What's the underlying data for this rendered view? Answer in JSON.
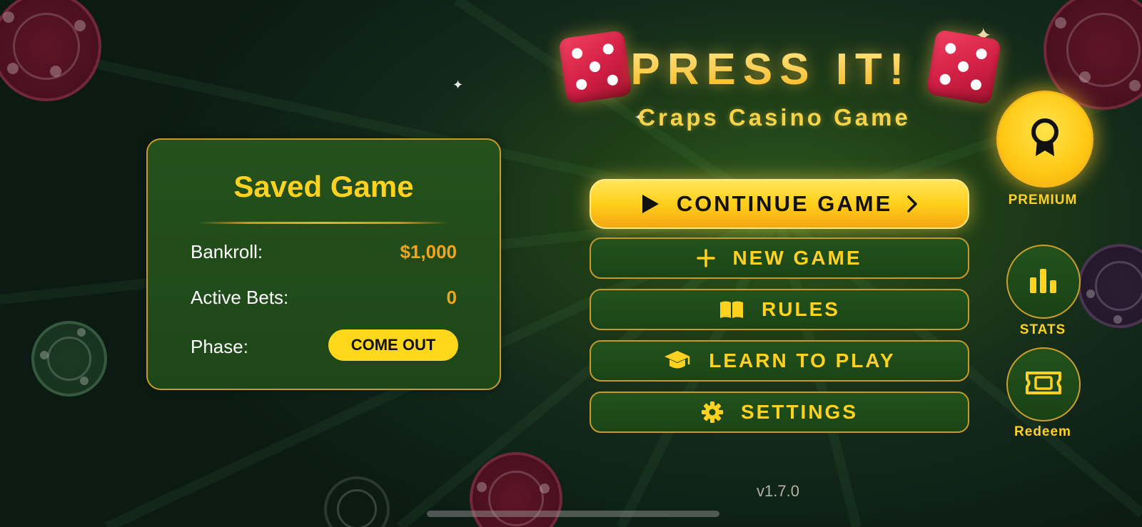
{
  "header": {
    "title": "PRESS IT!",
    "subtitle": "Craps Casino Game"
  },
  "saved_game": {
    "title": "Saved Game",
    "rows": [
      {
        "label": "Bankroll:",
        "value": "$1,000"
      },
      {
        "label": "Active Bets:",
        "value": "0"
      }
    ],
    "phase_label": "Phase:",
    "phase_value": "COME OUT"
  },
  "menu": {
    "continue": "CONTINUE GAME",
    "new_game": "NEW GAME",
    "rules": "RULES",
    "learn": "LEARN TO PLAY",
    "settings": "SETTINGS"
  },
  "side": {
    "premium": "PREMIUM",
    "stats": "STATS",
    "redeem": "Redeem"
  },
  "footer": {
    "version": "v1.7.0"
  },
  "icons": {
    "continue": "play-icon",
    "continue_arrow": "chevron-right-icon",
    "new_game": "plus-icon",
    "rules": "book-icon",
    "learn": "graduation-cap-icon",
    "settings": "gear-icon",
    "premium": "award-ribbon-icon",
    "stats": "bar-chart-icon",
    "redeem": "ticket-icon"
  },
  "colors": {
    "accent_gold": "#ffd21f",
    "felt_green": "#22531c",
    "value_orange": "#f2a41d",
    "die_red": "#d21f44"
  }
}
